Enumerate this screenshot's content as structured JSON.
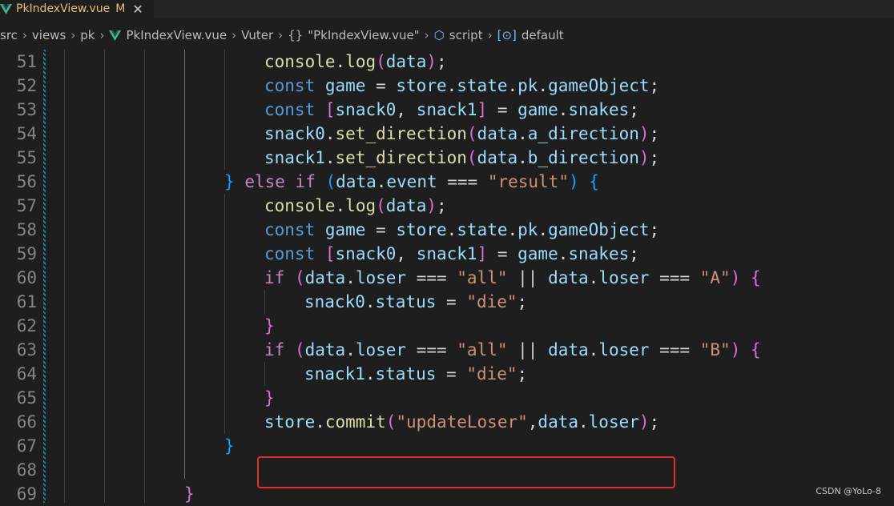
{
  "tab": {
    "filename": "PkIndexView.vue",
    "status": "M",
    "close_glyph": "✕"
  },
  "breadcrumb": {
    "items": [
      "src",
      "views",
      "pk",
      "PkIndexView.vue",
      "Vuter",
      "\"PkIndexView.vue\"",
      "script",
      "default"
    ]
  },
  "editor": {
    "lines": [
      {
        "num": "51",
        "indent": 330,
        "tokens": [
          [
            "fn",
            "console"
          ],
          [
            "pl",
            "."
          ],
          [
            "fn",
            "log"
          ],
          [
            "br2",
            "("
          ],
          [
            "var",
            "data"
          ],
          [
            "br2",
            ")"
          ],
          [
            "pl",
            ";"
          ]
        ]
      },
      {
        "num": "52",
        "indent": 330,
        "tokens": [
          [
            "kw",
            "const"
          ],
          [
            "pl",
            " "
          ],
          [
            "var",
            "game"
          ],
          [
            "pl",
            " = "
          ],
          [
            "var",
            "store"
          ],
          [
            "pl",
            "."
          ],
          [
            "var",
            "state"
          ],
          [
            "pl",
            "."
          ],
          [
            "var",
            "pk"
          ],
          [
            "pl",
            "."
          ],
          [
            "var",
            "gameObject"
          ],
          [
            "pl",
            ";"
          ]
        ]
      },
      {
        "num": "53",
        "indent": 330,
        "tokens": [
          [
            "kw",
            "const"
          ],
          [
            "pl",
            " "
          ],
          [
            "br2",
            "["
          ],
          [
            "var",
            "snack0"
          ],
          [
            "pl",
            ", "
          ],
          [
            "var",
            "snack1"
          ],
          [
            "br2",
            "]"
          ],
          [
            "pl",
            " = "
          ],
          [
            "var",
            "game"
          ],
          [
            "pl",
            "."
          ],
          [
            "var",
            "snakes"
          ],
          [
            "pl",
            ";"
          ]
        ]
      },
      {
        "num": "54",
        "indent": 330,
        "tokens": [
          [
            "var",
            "snack0"
          ],
          [
            "pl",
            "."
          ],
          [
            "fn",
            "set_direction"
          ],
          [
            "br2",
            "("
          ],
          [
            "var",
            "data"
          ],
          [
            "pl",
            "."
          ],
          [
            "var",
            "a_direction"
          ],
          [
            "br2",
            ")"
          ],
          [
            "pl",
            ";"
          ]
        ]
      },
      {
        "num": "55",
        "indent": 330,
        "tokens": [
          [
            "var",
            "snack1"
          ],
          [
            "pl",
            "."
          ],
          [
            "fn",
            "set_direction"
          ],
          [
            "br2",
            "("
          ],
          [
            "var",
            "data"
          ],
          [
            "pl",
            "."
          ],
          [
            "var",
            "b_direction"
          ],
          [
            "br2",
            ")"
          ],
          [
            "pl",
            ";"
          ]
        ]
      },
      {
        "num": "56",
        "indent": 280,
        "tokens": [
          [
            "br3",
            "}"
          ],
          [
            "pl",
            " "
          ],
          [
            "ctl",
            "else"
          ],
          [
            "pl",
            " "
          ],
          [
            "ctl",
            "if"
          ],
          [
            "pl",
            " "
          ],
          [
            "br3",
            "("
          ],
          [
            "var",
            "data"
          ],
          [
            "pl",
            "."
          ],
          [
            "var",
            "event"
          ],
          [
            "pl",
            " === "
          ],
          [
            "str",
            "\"result\""
          ],
          [
            "br3",
            ")"
          ],
          [
            "pl",
            " "
          ],
          [
            "br3",
            "{"
          ]
        ]
      },
      {
        "num": "57",
        "indent": 330,
        "tokens": [
          [
            "fn",
            "console"
          ],
          [
            "pl",
            "."
          ],
          [
            "fn",
            "log"
          ],
          [
            "br2",
            "("
          ],
          [
            "var",
            "data"
          ],
          [
            "br2",
            ")"
          ],
          [
            "pl",
            ";"
          ]
        ]
      },
      {
        "num": "58",
        "indent": 330,
        "tokens": [
          [
            "kw",
            "const"
          ],
          [
            "pl",
            " "
          ],
          [
            "var",
            "game"
          ],
          [
            "pl",
            " = "
          ],
          [
            "var",
            "store"
          ],
          [
            "pl",
            "."
          ],
          [
            "var",
            "state"
          ],
          [
            "pl",
            "."
          ],
          [
            "var",
            "pk"
          ],
          [
            "pl",
            "."
          ],
          [
            "var",
            "gameObject"
          ],
          [
            "pl",
            ";"
          ]
        ]
      },
      {
        "num": "59",
        "indent": 330,
        "tokens": [
          [
            "kw",
            "const"
          ],
          [
            "pl",
            " "
          ],
          [
            "br2",
            "["
          ],
          [
            "var",
            "snack0"
          ],
          [
            "pl",
            ", "
          ],
          [
            "var",
            "snack1"
          ],
          [
            "br2",
            "]"
          ],
          [
            "pl",
            " = "
          ],
          [
            "var",
            "game"
          ],
          [
            "pl",
            "."
          ],
          [
            "var",
            "snakes"
          ],
          [
            "pl",
            ";"
          ]
        ]
      },
      {
        "num": "60",
        "indent": 330,
        "tokens": [
          [
            "ctl",
            "if"
          ],
          [
            "pl",
            " "
          ],
          [
            "br2",
            "("
          ],
          [
            "var",
            "data"
          ],
          [
            "pl",
            "."
          ],
          [
            "var",
            "loser"
          ],
          [
            "pl",
            " === "
          ],
          [
            "str",
            "\"all\""
          ],
          [
            "pl",
            " || "
          ],
          [
            "var",
            "data"
          ],
          [
            "pl",
            "."
          ],
          [
            "var",
            "loser"
          ],
          [
            "pl",
            " === "
          ],
          [
            "str",
            "\"A\""
          ],
          [
            "br2",
            ")"
          ],
          [
            "pl",
            " "
          ],
          [
            "br2",
            "{"
          ]
        ]
      },
      {
        "num": "61",
        "indent": 380,
        "tokens": [
          [
            "var",
            "snack0"
          ],
          [
            "pl",
            "."
          ],
          [
            "var",
            "status"
          ],
          [
            "pl",
            " = "
          ],
          [
            "str",
            "\"die\""
          ],
          [
            "pl",
            ";"
          ]
        ]
      },
      {
        "num": "62",
        "indent": 330,
        "tokens": [
          [
            "br2",
            "}"
          ]
        ]
      },
      {
        "num": "63",
        "indent": 330,
        "tokens": [
          [
            "ctl",
            "if"
          ],
          [
            "pl",
            " "
          ],
          [
            "br2",
            "("
          ],
          [
            "var",
            "data"
          ],
          [
            "pl",
            "."
          ],
          [
            "var",
            "loser"
          ],
          [
            "pl",
            " === "
          ],
          [
            "str",
            "\"all\""
          ],
          [
            "pl",
            " || "
          ],
          [
            "var",
            "data"
          ],
          [
            "pl",
            "."
          ],
          [
            "var",
            "loser"
          ],
          [
            "pl",
            " === "
          ],
          [
            "str",
            "\"B\""
          ],
          [
            "br2",
            ")"
          ],
          [
            "pl",
            " "
          ],
          [
            "br2",
            "{"
          ]
        ]
      },
      {
        "num": "64",
        "indent": 380,
        "tokens": [
          [
            "var",
            "snack1"
          ],
          [
            "pl",
            "."
          ],
          [
            "var",
            "status"
          ],
          [
            "pl",
            " = "
          ],
          [
            "str",
            "\"die\""
          ],
          [
            "pl",
            ";"
          ]
        ]
      },
      {
        "num": "65",
        "indent": 330,
        "tokens": [
          [
            "br2",
            "}"
          ]
        ]
      },
      {
        "num": "66",
        "indent": 330,
        "tokens": [
          [
            "var",
            "store"
          ],
          [
            "pl",
            "."
          ],
          [
            "fn",
            "commit"
          ],
          [
            "br2",
            "("
          ],
          [
            "str",
            "\"updateLoser\""
          ],
          [
            "pl",
            ","
          ],
          [
            "var",
            "data"
          ],
          [
            "pl",
            "."
          ],
          [
            "var",
            "loser"
          ],
          [
            "br2",
            ")"
          ],
          [
            "pl",
            ";"
          ]
        ]
      },
      {
        "num": "67",
        "indent": 280,
        "tokens": [
          [
            "br3",
            "}"
          ]
        ]
      },
      {
        "num": "68",
        "indent": 0,
        "tokens": []
      },
      {
        "num": "69",
        "indent": 230,
        "tokens": [
          [
            "br2",
            "}"
          ]
        ]
      }
    ]
  },
  "watermark": "CSDN @YoLo-8"
}
